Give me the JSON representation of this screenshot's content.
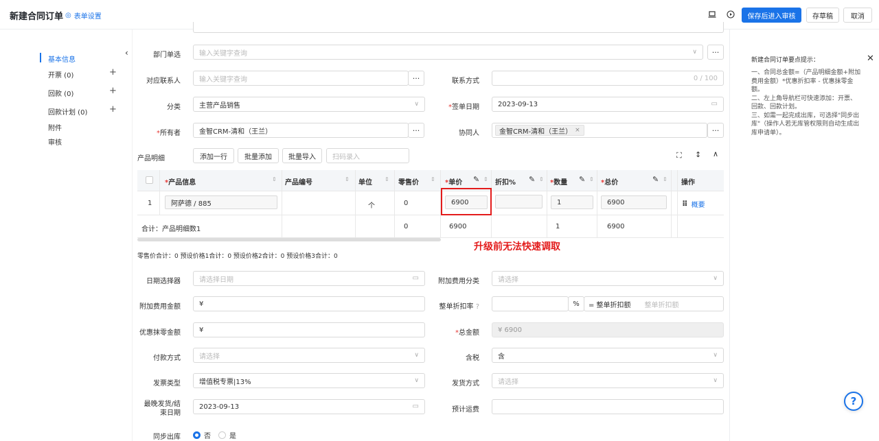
{
  "header": {
    "title": "新建合同订单",
    "form_settings": "表单设置",
    "save_submit": "保存后进入审核",
    "save_draft": "存草稿",
    "cancel": "取消"
  },
  "sidebar": {
    "items": [
      {
        "label": "基本信息"
      },
      {
        "label": "开票  (0)"
      },
      {
        "label": "回款  (0)"
      },
      {
        "label": "回款计划  (0)"
      },
      {
        "label": "附件"
      },
      {
        "label": "审核"
      }
    ]
  },
  "form": {
    "dept_label": "部门单选",
    "dept_placeholder": "输入关键字查询",
    "contact_label": "对应联系人",
    "contact_placeholder": "输入关键字查询",
    "contact_method_label": "联系方式",
    "contact_method_counter": "0 / 100",
    "category_label": "分类",
    "category_value": "主营产品销售",
    "sign_date_label": "签单日期",
    "sign_date_value": "2023-09-13",
    "owner_label": "所有者",
    "owner_value": "金智CRM-清和（王兰）",
    "collab_label": "协同人",
    "collab_value": "金智CRM-清和（王兰）"
  },
  "products": {
    "section_label": "产品明细",
    "add_row": "添加一行",
    "batch_add": "批量添加",
    "batch_import": "批量导入",
    "scan_placeholder": "扫码录入",
    "columns": [
      "产品信息",
      "产品编号",
      "单位",
      "零售价",
      "单价",
      "折扣%",
      "数量",
      "总价",
      "操作"
    ],
    "row": {
      "index": "1",
      "product": "阿萨德 / 885",
      "unit": "个",
      "retail": "0",
      "price": "6900",
      "qty": "1",
      "total": "6900",
      "action": "概要"
    },
    "sum": {
      "label": "合计：产品明细数1",
      "retail": "0",
      "price": "6900",
      "qty": "1",
      "total": "6900"
    },
    "annotation": "升级前无法快速调取",
    "price_totals": "零售价合计：0  预设价格1合计：0  预设价格2合计：0  预设价格3合计：0"
  },
  "form2": {
    "date_picker_label": "日期选择器",
    "date_picker_placeholder": "请选择日期",
    "extra_fee_type_label": "附加费用分类",
    "extra_fee_type_placeholder": "请选择",
    "extra_fee_amount_label": "附加费用金额",
    "currency_symbol": "¥",
    "discount_rate_label": "整单折扣率",
    "percent": "%",
    "equals_discount": "= 整单折扣额",
    "discount_amount_placeholder": "整单折扣额",
    "rounding_label": "优惠抹零金额",
    "total_label": "总金额",
    "total_value": "¥  6900",
    "payment_label": "付款方式",
    "payment_placeholder": "请选择",
    "tax_label": "含税",
    "tax_value": "含",
    "invoice_type_label": "发票类型",
    "invoice_type_value": "增值税专票|13%",
    "ship_method_label": "发货方式",
    "ship_method_placeholder": "请选择",
    "latest_ship_label_1": "最晚发货/结",
    "latest_ship_label_2": "束日期",
    "latest_ship_value": "2023-09-13",
    "est_freight_label": "预计运费",
    "sync_out_label": "同步出库",
    "sync_no": "否",
    "sync_yes": "是"
  },
  "tips": {
    "title": "新建合同订单要点提示：",
    "line1": "一、合同总金额=（产品明细金额+附加费用金额）*优惠折扣率 - 优惠抹零金额。",
    "line2": "二、左上角导航栏可快速添加：开票、回款、回款计划。",
    "line3": "三、如需一起完成出库，可选择\"同步出库\"（操作人若无库管权限则自动生成出库申请单）。"
  },
  "colors": {
    "primary": "#1a73e8",
    "annotation_red": "#e31b1b"
  }
}
